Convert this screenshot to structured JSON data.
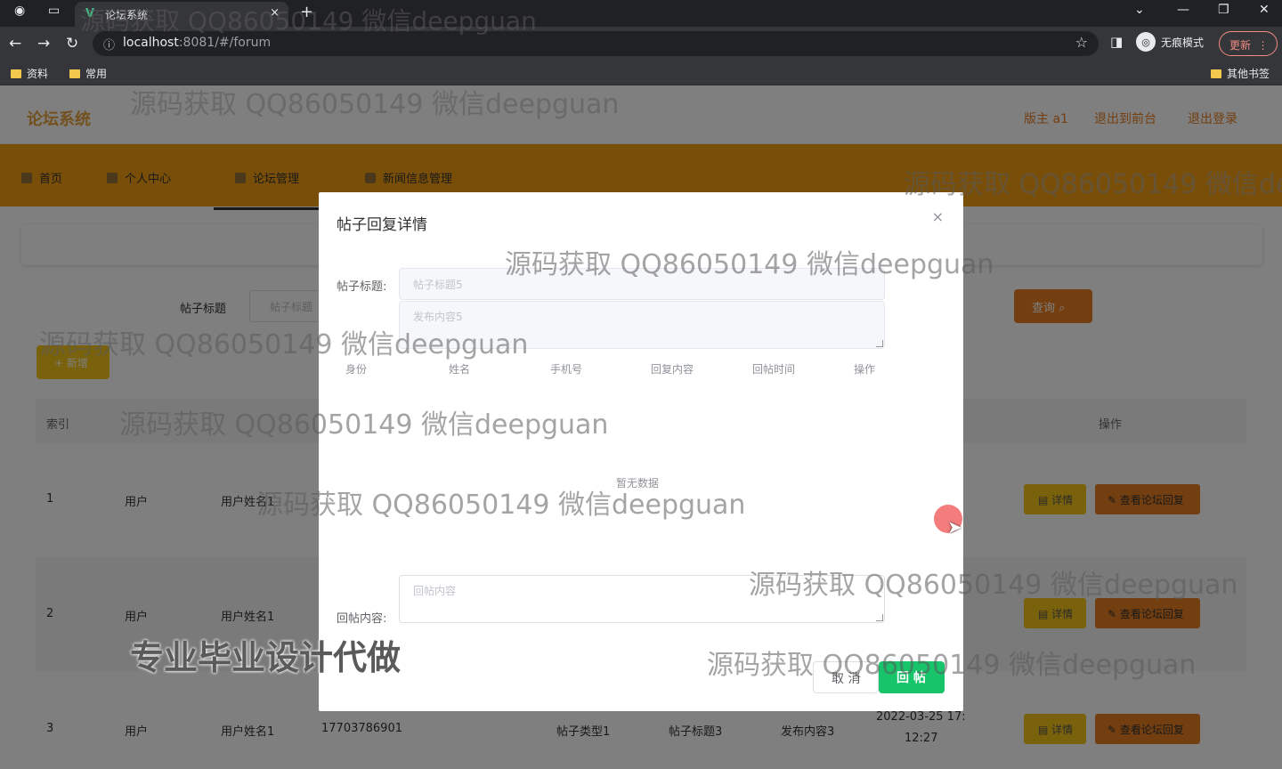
{
  "browser": {
    "tab_title": "论坛系统",
    "new_tab": "+",
    "tab_close": "×",
    "url_host": "localhost",
    "url_path": ":8081/#/forum",
    "incognito_label": "无痕模式",
    "update_label": "更新",
    "bookmarks": [
      "资料",
      "常用"
    ],
    "other_bookmarks": "其他书签"
  },
  "header": {
    "brand": "论坛系统",
    "links": [
      "版主 a1",
      "退出到前台",
      "退出登录"
    ]
  },
  "nav": {
    "items": [
      "首页",
      "个人中心",
      "论坛管理",
      "新闻信息管理"
    ]
  },
  "search": {
    "label": "帖子标题",
    "placeholder": "帖子标题",
    "query_button": "查询",
    "add_button": "+ 新增"
  },
  "table": {
    "columns": [
      "索引",
      "操作"
    ],
    "rows": [
      {
        "index": "1",
        "role": "用户",
        "name": "用户姓名1",
        "phone": "",
        "type": "",
        "title": "",
        "content": "",
        "time_line1": "",
        "time_line2": ""
      },
      {
        "index": "2",
        "role": "用户",
        "name": "用户姓名1",
        "phone": "",
        "type": "",
        "title": "",
        "content": "",
        "time_line1": "",
        "time_line2": ""
      },
      {
        "index": "3",
        "role": "用户",
        "name": "用户姓名1",
        "phone": "17703786901",
        "type": "帖子类型1",
        "title": "帖子标题3",
        "content": "发布内容3",
        "time_line1": "2022-03-25 17:",
        "time_line2": "12:27"
      }
    ],
    "detail_button": "详情",
    "reply_button": "查看论坛回复"
  },
  "dialog": {
    "title": "帖子回复详情",
    "close": "×",
    "title_label": "帖子标题:",
    "title_value": "帖子标题5",
    "content_placeholder": "发布内容5",
    "reply_columns": [
      "身份",
      "姓名",
      "手机号",
      "回复内容",
      "回帖时间",
      "操作"
    ],
    "empty_text": "暂无数据",
    "reply_label": "回帖内容:",
    "reply_placeholder": "回帖内容",
    "cancel_button": "取 消",
    "submit_button": "回 帖"
  },
  "watermarks": {
    "repeat": "源码获取 QQ86050149 微信deepguan",
    "promo": "专业毕业设计代做"
  },
  "colors": {
    "accent": "#f39c12",
    "brand": "#e6a23c",
    "submit": "#18c46a",
    "detail": "#f5c518",
    "reply": "#e67e22"
  }
}
